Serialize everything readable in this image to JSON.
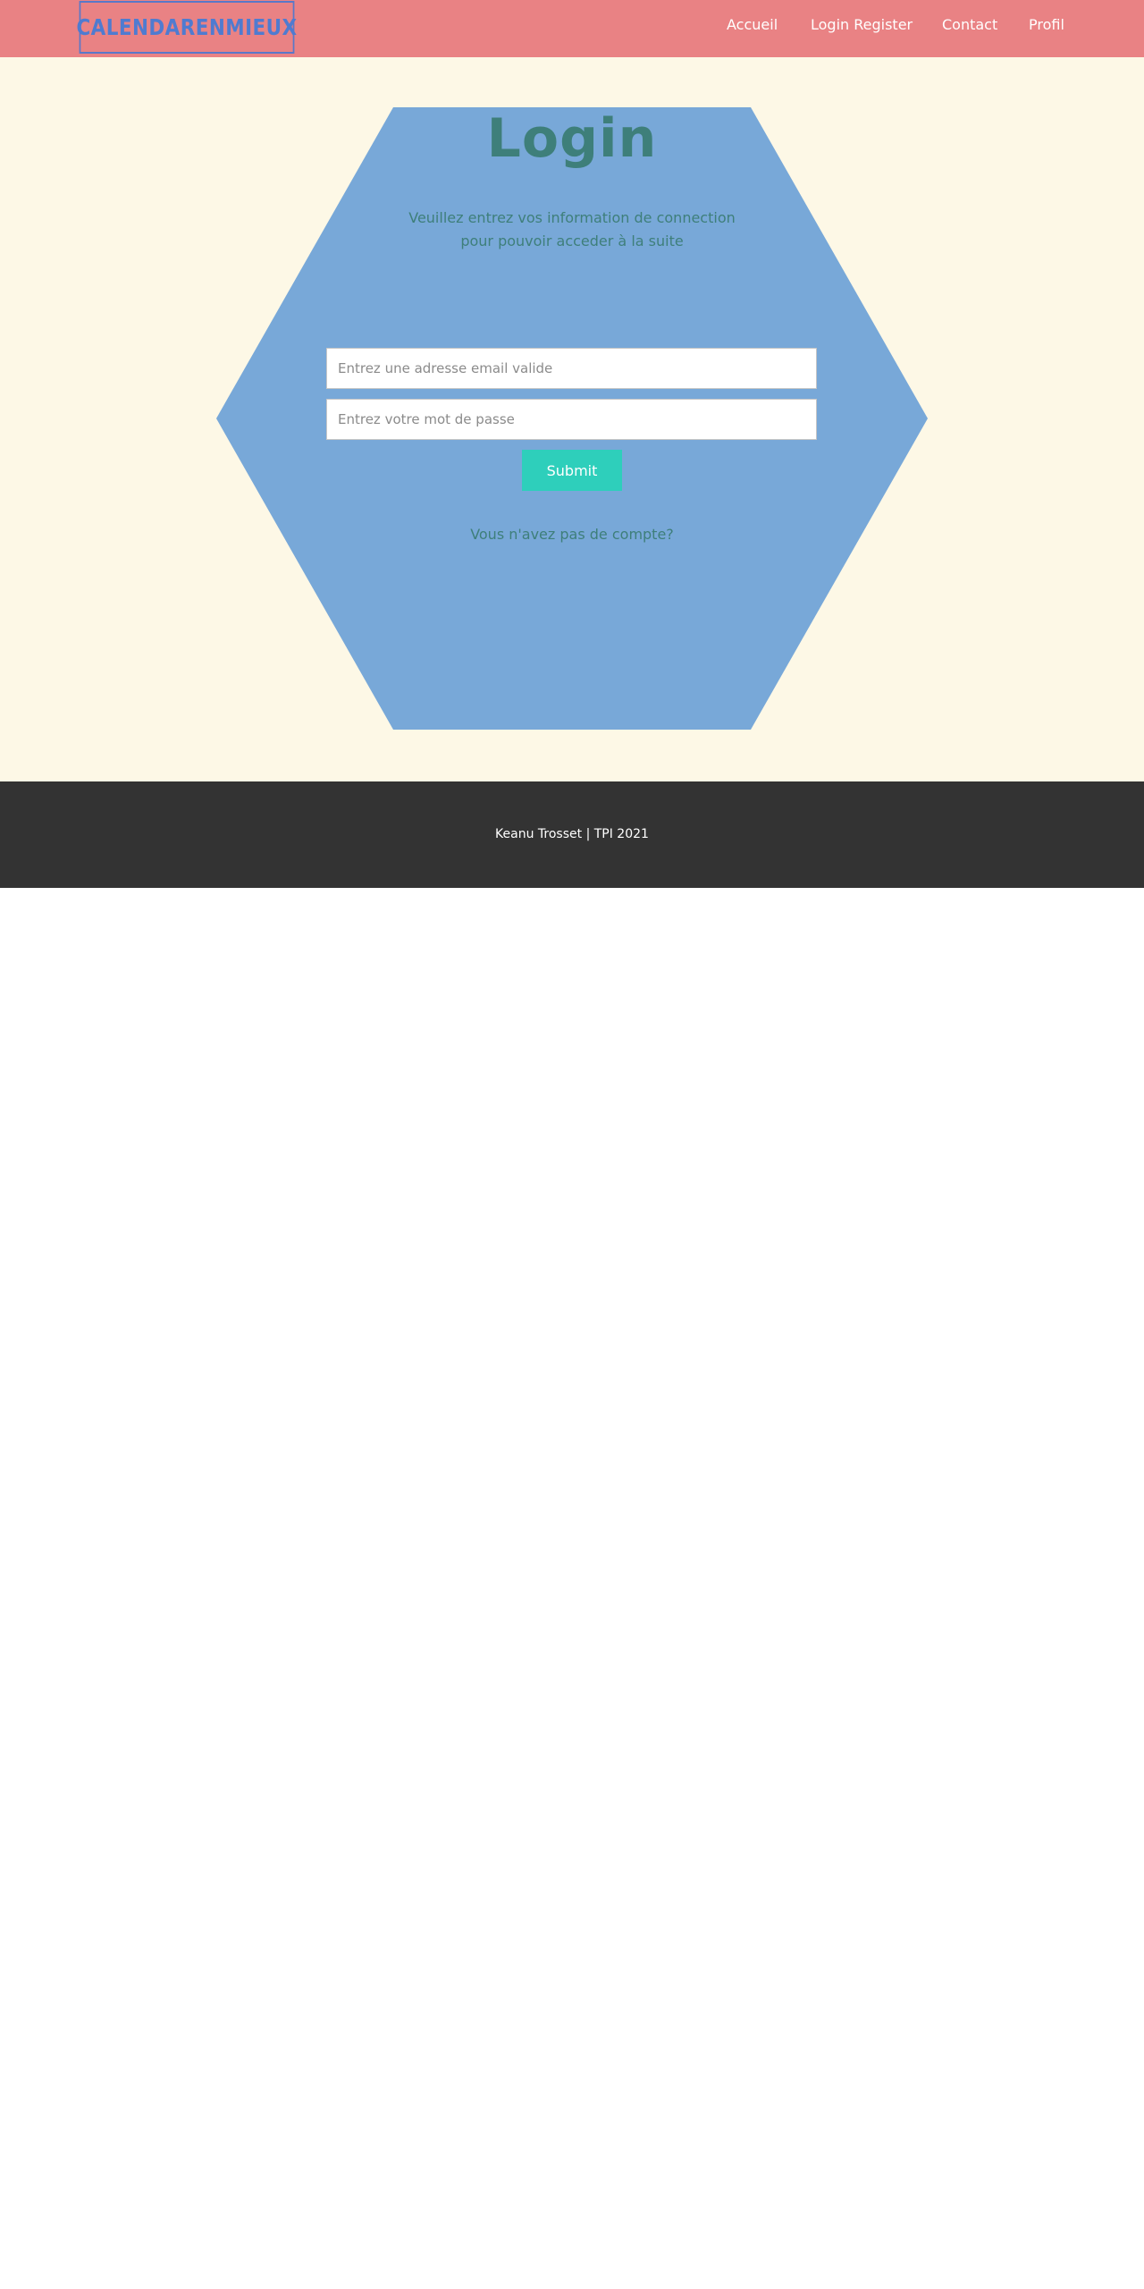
{
  "header": {
    "logo": "CALENDARENMIEUX",
    "nav": [
      "Accueil",
      "Login Register",
      "Contact",
      "Profil"
    ]
  },
  "login": {
    "title": "Login",
    "subtitle": "Veuillez entrez vos information de connection pour pouvoir acceder à la suite",
    "email_placeholder": "Entrez une adresse email valide",
    "password_placeholder": "Entrez votre mot de passe",
    "submit_label": "Submit",
    "signup_link": "Vous n'avez pas de compte?"
  },
  "footer": {
    "text": "Keanu Trosset | TPI 2021"
  },
  "colors": {
    "header_bg": "#e98284",
    "main_bg": "#fdf8e6",
    "hexagon": "#78a8d8",
    "text_teal": "#3e7f7a",
    "button": "#2ecfbb",
    "footer_bg": "#333333",
    "logo": "#4f7bd0"
  }
}
